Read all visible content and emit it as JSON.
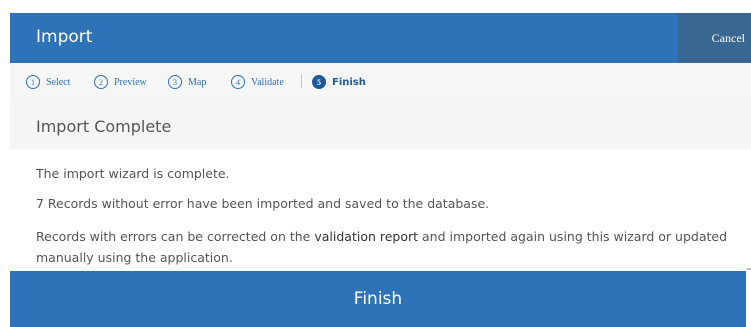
{
  "header": {
    "title": "Import",
    "cancel_label": "Cancel"
  },
  "steps": [
    {
      "num": "1",
      "label": "Select"
    },
    {
      "num": "2",
      "label": "Preview"
    },
    {
      "num": "3",
      "label": "Map"
    },
    {
      "num": "4",
      "label": "Validate"
    },
    {
      "num": "5",
      "label": "Finish"
    }
  ],
  "content": {
    "title": "Import Complete",
    "line1": "The import wizard is complete.",
    "line2": "7 Records without error have been imported and saved to the database.",
    "line3_pre": "Records with errors can be corrected on the ",
    "line3_link": "validation report",
    "line3_post": " and imported again using this wizard or updated manually using the application."
  },
  "footer": {
    "finish_label": "Finish"
  },
  "colors": {
    "primary": "#2e73b8",
    "cancel_bg": "#3a6791",
    "active_step": "#1e5a98"
  }
}
